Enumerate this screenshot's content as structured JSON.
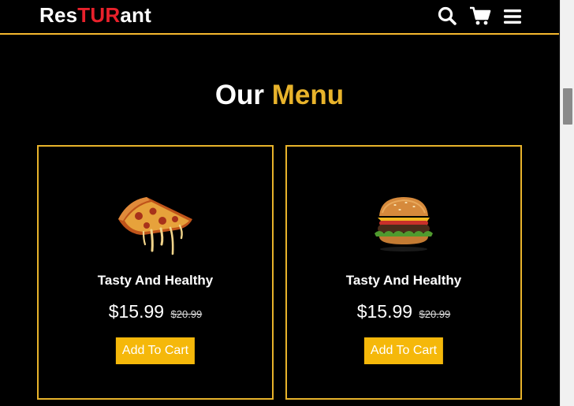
{
  "header": {
    "logo_part1": "Res",
    "logo_part2": "TUR",
    "logo_part3": "ant",
    "icons": [
      "search-icon",
      "cart-icon",
      "menu-icon"
    ]
  },
  "section": {
    "title_part1": "Our",
    "title_part2": "Menu"
  },
  "menu_items": [
    {
      "image": "pizza-slice-image",
      "name": "Tasty And Healthy",
      "price": "$15.99",
      "old_price": "$20.99",
      "button_label": "Add To Cart"
    },
    {
      "image": "burger-image",
      "name": "Tasty And Healthy",
      "price": "$15.99",
      "old_price": "$20.99",
      "button_label": "Add To Cart"
    }
  ],
  "colors": {
    "background": "#000000",
    "accent_gold": "#e8b32b",
    "button_yellow": "#f5b80a",
    "logo_red": "#e8212b"
  }
}
